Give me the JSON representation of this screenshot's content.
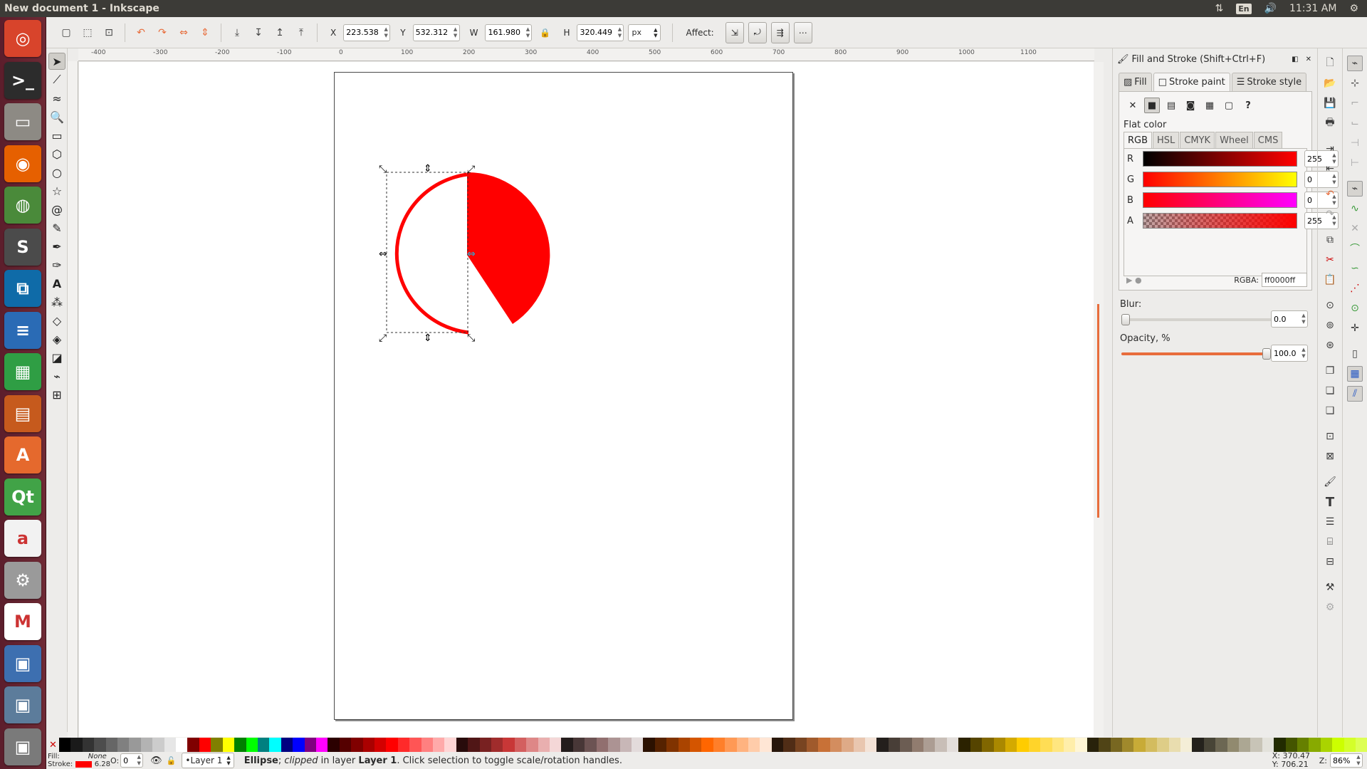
{
  "window": {
    "title": "New document 1 - Inkscape",
    "tray": {
      "keyboard": "En",
      "clock": "11:31 AM"
    }
  },
  "launcher": [
    {
      "name": "ubuntu-dash-icon",
      "color": "#d8442b",
      "glyph": "◎"
    },
    {
      "name": "terminal-icon",
      "color": "#2c2c2c",
      "glyph": ">_"
    },
    {
      "name": "files-icon",
      "color": "#8d8a84",
      "glyph": "▭"
    },
    {
      "name": "firefox-icon",
      "color": "#e66000",
      "glyph": "◉"
    },
    {
      "name": "chrome-icon",
      "color": "#4a8a3a",
      "glyph": "◍"
    },
    {
      "name": "sublime-text-icon",
      "color": "#4b4b4b",
      "glyph": "S"
    },
    {
      "name": "pycharm-icon",
      "color": "#0f6ba8",
      "glyph": "⧉"
    },
    {
      "name": "writer-icon",
      "color": "#2a6bb5",
      "glyph": "≡"
    },
    {
      "name": "calc-icon",
      "color": "#2f9e44",
      "glyph": "▦"
    },
    {
      "name": "impress-icon",
      "color": "#c65a1d",
      "glyph": "▤"
    },
    {
      "name": "software-center-icon",
      "color": "#e5692d",
      "glyph": "A"
    },
    {
      "name": "qt-creator-icon",
      "color": "#41a347",
      "glyph": "Qt"
    },
    {
      "name": "amazon-icon",
      "color": "#f2f2f2",
      "glyph": "a"
    },
    {
      "name": "system-settings-icon",
      "color": "#9a9a9a",
      "glyph": "⚙"
    },
    {
      "name": "gmail-icon",
      "color": "#ffffff",
      "glyph": "M"
    },
    {
      "name": "app-icon-1",
      "color": "#3d6fb0",
      "glyph": "▣"
    },
    {
      "name": "app-icon-2",
      "color": "#5c7c9b",
      "glyph": "▣"
    },
    {
      "name": "app-icon-3",
      "color": "#7a7a7a",
      "glyph": "▣"
    }
  ],
  "controls": {
    "x_label": "X",
    "x_value": "223.538",
    "y_label": "Y",
    "y_value": "532.312",
    "w_label": "W",
    "w_value": "161.980",
    "h_label": "H",
    "h_value": "320.449",
    "unit": "px",
    "affect_label": "Affect:"
  },
  "ruler": {
    "h_labels": [
      "-400",
      "-300",
      "-200",
      "-100",
      "0",
      "100",
      "200",
      "300",
      "400",
      "500",
      "600",
      "700",
      "800",
      "900",
      "1000",
      "1100"
    ]
  },
  "dock": {
    "title": "Fill and Stroke (Shift+Ctrl+F)",
    "tabs": [
      "Fill",
      "Stroke paint",
      "Stroke style"
    ],
    "flat_color_label": "Flat color",
    "color_tabs": [
      "RGB",
      "HSL",
      "CMYK",
      "Wheel",
      "CMS"
    ],
    "channels": [
      {
        "label": "R",
        "value": "255"
      },
      {
        "label": "G",
        "value": "0"
      },
      {
        "label": "B",
        "value": "0"
      },
      {
        "label": "A",
        "value": "255"
      }
    ],
    "rgba_label": "RGBA:",
    "rgba_value": "ff0000ff",
    "blur_label": "Blur:",
    "blur_value": "0.0",
    "blur_fraction": 0.0,
    "opacity_label": "Opacity, %",
    "opacity_value": "100.0",
    "opacity_fraction": 1.0
  },
  "colors": {
    "accent": "#e86d3c",
    "stroke": "#ff0000",
    "shape_fill": "#ff0000"
  },
  "status": {
    "fill_label": "Fill:",
    "fill_value": "None",
    "stroke_label": "Stroke:",
    "stroke_width": "6.28",
    "opacity_label": "O:",
    "opacity_value": "0",
    "layer": "•Layer 1",
    "msg_object": "Ellipse",
    "msg_clip": "clipped",
    "msg_in_layer": "in layer",
    "msg_layer_name": "Layer 1",
    "msg_rest": ". Click selection to toggle scale/rotation handles.",
    "cursor_x": "X:  370.47",
    "cursor_y": "Y:  706.21",
    "zoom_label": "Z:",
    "zoom_value": "86%"
  },
  "palette": [
    "#000000",
    "#1a1a1a",
    "#333333",
    "#4d4d4d",
    "#666666",
    "#808080",
    "#999999",
    "#b3b3b3",
    "#cccccc",
    "#e6e6e6",
    "#ffffff",
    "#800000",
    "#ff0000",
    "#808000",
    "#ffff00",
    "#008000",
    "#00ff00",
    "#008080",
    "#00ffff",
    "#000080",
    "#0000ff",
    "#800080",
    "#ff00ff",
    "#2b0000",
    "#550000",
    "#800000",
    "#aa0000",
    "#d40000",
    "#ff0000",
    "#ff2a2a",
    "#ff5555",
    "#ff8080",
    "#ffaaaa",
    "#ffd5d5",
    "#280b0b",
    "#501616",
    "#782121",
    "#a02c2c",
    "#c83737",
    "#d35f5f",
    "#de8787",
    "#e9afaf",
    "#f4d7d7",
    "#241c1c",
    "#483737",
    "#6c5353",
    "#916f6f",
    "#ac9393",
    "#c8b7b7",
    "#e3dbdb",
    "#2b1100",
    "#552200",
    "#803300",
    "#aa4400",
    "#d45500",
    "#ff6600",
    "#ff7f2a",
    "#ff9955",
    "#ffb380",
    "#ffccaa",
    "#ffe6d5",
    "#28170b",
    "#502d16",
    "#784421",
    "#a05a2c",
    "#c87137",
    "#d38d5f",
    "#deaa87",
    "#e9c6af",
    "#f4e3d7",
    "#241f1c",
    "#483e37",
    "#6c5d53",
    "#917c6f",
    "#ac9d93",
    "#c8beb7",
    "#e3dedb",
    "#2b2200",
    "#554400",
    "#806600",
    "#aa8800",
    "#d4aa00",
    "#ffcc00",
    "#ffd42a",
    "#ffdd55",
    "#ffe680",
    "#ffeeaa",
    "#fff6d5",
    "#28220b",
    "#504416",
    "#786721",
    "#a0892c",
    "#c8ab37",
    "#d3bc5f",
    "#decd87",
    "#e9ddaf",
    "#f4eed7",
    "#24221c",
    "#484537",
    "#6c6753",
    "#918a6f",
    "#aca793",
    "#c8c4b7",
    "#e3e2db",
    "#222b00",
    "#445500",
    "#668000",
    "#88aa00",
    "#aad400",
    "#ccff00",
    "#d4ff2a",
    "#ddff55"
  ]
}
